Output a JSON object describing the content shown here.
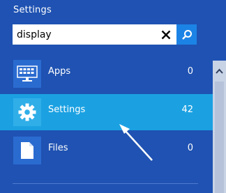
{
  "panel": {
    "title": "Settings"
  },
  "search": {
    "value": "display",
    "clear_icon": "close-icon",
    "submit_icon": "search-icon"
  },
  "results": [
    {
      "label": "Apps",
      "count": "0",
      "icon": "apps-icon",
      "selected": false
    },
    {
      "label": "Settings",
      "count": "42",
      "icon": "gear-icon",
      "selected": true
    },
    {
      "label": "Files",
      "count": "0",
      "icon": "file-icon",
      "selected": false
    }
  ],
  "colors": {
    "background": "#1f52b2",
    "selected_row": "#1ba1e2",
    "search_button": "#1c83e6",
    "scrollbar": "#c8d3e6"
  }
}
